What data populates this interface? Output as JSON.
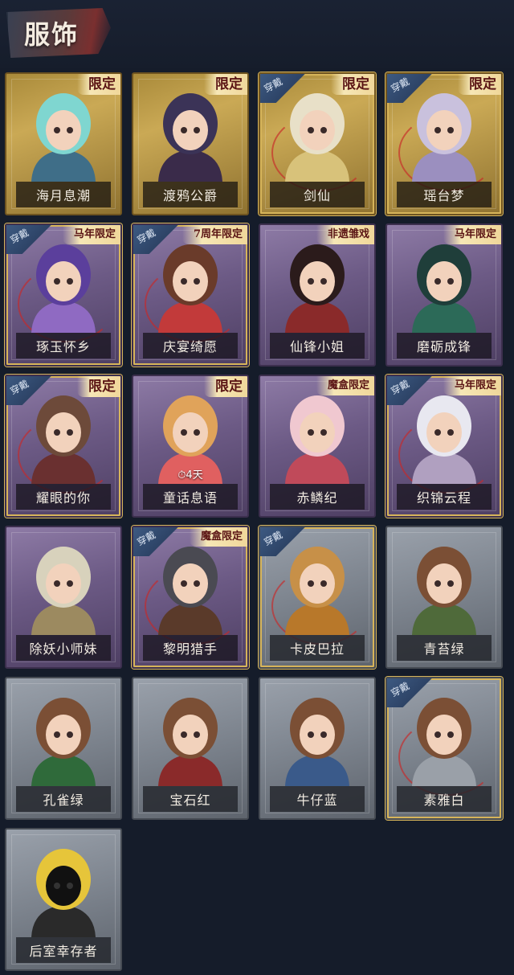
{
  "header": {
    "title": "服饰"
  },
  "colors": {
    "background": "#151c2a",
    "gold_frame": "#caa955",
    "purple_frame": "#6c5a85",
    "gray_frame": "#7c838d",
    "limited_text": "#5a1414",
    "worn_badge": "#2d4366"
  },
  "costumes": [
    {
      "name": "海月息潮",
      "tag": "限定",
      "worn": "",
      "timer": ""
    },
    {
      "name": "渡鸦公爵",
      "tag": "限定",
      "worn": "",
      "timer": ""
    },
    {
      "name": "剑仙",
      "tag": "限定",
      "worn": "穿戴",
      "timer": ""
    },
    {
      "name": "瑶台梦",
      "tag": "限定",
      "worn": "穿戴",
      "timer": ""
    },
    {
      "name": "琢玉怀乡",
      "tag": "马年限定",
      "worn": "穿戴",
      "timer": ""
    },
    {
      "name": "庆宴绮愿",
      "tag": "7周年限定",
      "worn": "穿戴",
      "timer": ""
    },
    {
      "name": "仙锋小姐",
      "tag": "非遗雏戏",
      "worn": "",
      "timer": ""
    },
    {
      "name": "磨砺成锋",
      "tag": "马年限定",
      "worn": "",
      "timer": ""
    },
    {
      "name": "耀眼的你",
      "tag": "限定",
      "worn": "穿戴",
      "timer": ""
    },
    {
      "name": "童话息语",
      "tag": "限定",
      "worn": "",
      "timer": "⏱4天"
    },
    {
      "name": "赤鳞纪",
      "tag": "魔盒限定",
      "worn": "",
      "timer": ""
    },
    {
      "name": "织锦云程",
      "tag": "马年限定",
      "worn": "穿戴",
      "timer": ""
    },
    {
      "name": "除妖小师妹",
      "tag": "",
      "worn": "",
      "timer": ""
    },
    {
      "name": "黎明猎手",
      "tag": "魔盒限定",
      "worn": "穿戴",
      "timer": ""
    },
    {
      "name": "卡皮巴拉",
      "tag": "",
      "worn": "穿戴",
      "timer": ""
    },
    {
      "name": "青苔绿",
      "tag": "",
      "worn": "",
      "timer": ""
    },
    {
      "name": "孔雀绿",
      "tag": "",
      "worn": "",
      "timer": ""
    },
    {
      "name": "宝石红",
      "tag": "",
      "worn": "",
      "timer": ""
    },
    {
      "name": "牛仔蓝",
      "tag": "",
      "worn": "",
      "timer": ""
    },
    {
      "name": "素雅白",
      "tag": "",
      "worn": "穿戴",
      "timer": ""
    },
    {
      "name": "后室幸存者",
      "tag": "",
      "worn": "",
      "timer": ""
    }
  ]
}
